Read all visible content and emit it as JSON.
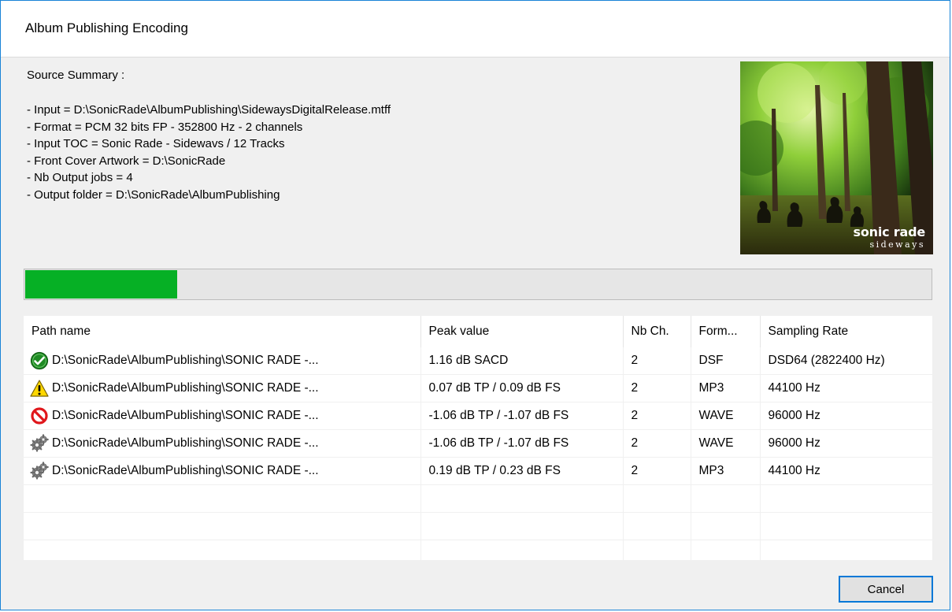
{
  "window": {
    "title": "Album Publishing Encoding"
  },
  "summary": {
    "heading": "Source Summary :",
    "lines": [
      "- Input = D:\\SonicRade\\AlbumPublishing\\SidewaysDigitalRelease.mtff",
      "- Format = PCM 32 bits FP - 352800 Hz - 2 channels",
      "- Input TOC = Sonic Rade - Sidewavs / 12 Tracks",
      "- Front Cover Artwork = D:\\SonicRade",
      "- Nb Output jobs = 4",
      "- Output folder = D:\\SonicRade\\AlbumPublishing"
    ]
  },
  "cover": {
    "title": "sonic rade",
    "subtitle": "sideways"
  },
  "progress": {
    "fraction": 0.168,
    "color": "#06b025"
  },
  "table": {
    "columns": [
      "Path name",
      "Peak value",
      "Nb Ch.",
      "Form...",
      "Sampling Rate"
    ],
    "rows": [
      {
        "status": "check-icon",
        "path": "D:\\SonicRade\\AlbumPublishing\\SONIC RADE -...",
        "peak": "1.16 dB SACD",
        "channels": "2",
        "format": "DSF",
        "rate": "DSD64 (2822400 Hz)"
      },
      {
        "status": "warning-icon",
        "path": "D:\\SonicRade\\AlbumPublishing\\SONIC RADE -...",
        "peak": "0.07 dB TP / 0.09 dB FS",
        "channels": "2",
        "format": "MP3",
        "rate": "44100 Hz"
      },
      {
        "status": "prohibited-icon",
        "path": "D:\\SonicRade\\AlbumPublishing\\SONIC RADE -...",
        "peak": "-1.06 dB TP / -1.07 dB FS",
        "channels": "2",
        "format": "WAVE",
        "rate": "96000 Hz"
      },
      {
        "status": "gears-icon",
        "path": "D:\\SonicRade\\AlbumPublishing\\SONIC RADE -...",
        "peak": "-1.06 dB TP / -1.07 dB FS",
        "channels": "2",
        "format": "WAVE",
        "rate": "96000 Hz"
      },
      {
        "status": "gears-icon",
        "path": "D:\\SonicRade\\AlbumPublishing\\SONIC RADE -...",
        "peak": "0.19 dB TP / 0.23 dB FS",
        "channels": "2",
        "format": "MP3",
        "rate": "44100 Hz"
      }
    ]
  },
  "colors": {
    "accent": "#0078d7",
    "ok": "#1f8b24",
    "warning": "#ffd800",
    "error": "#e0171c"
  },
  "buttons": {
    "cancel": "Cancel"
  }
}
